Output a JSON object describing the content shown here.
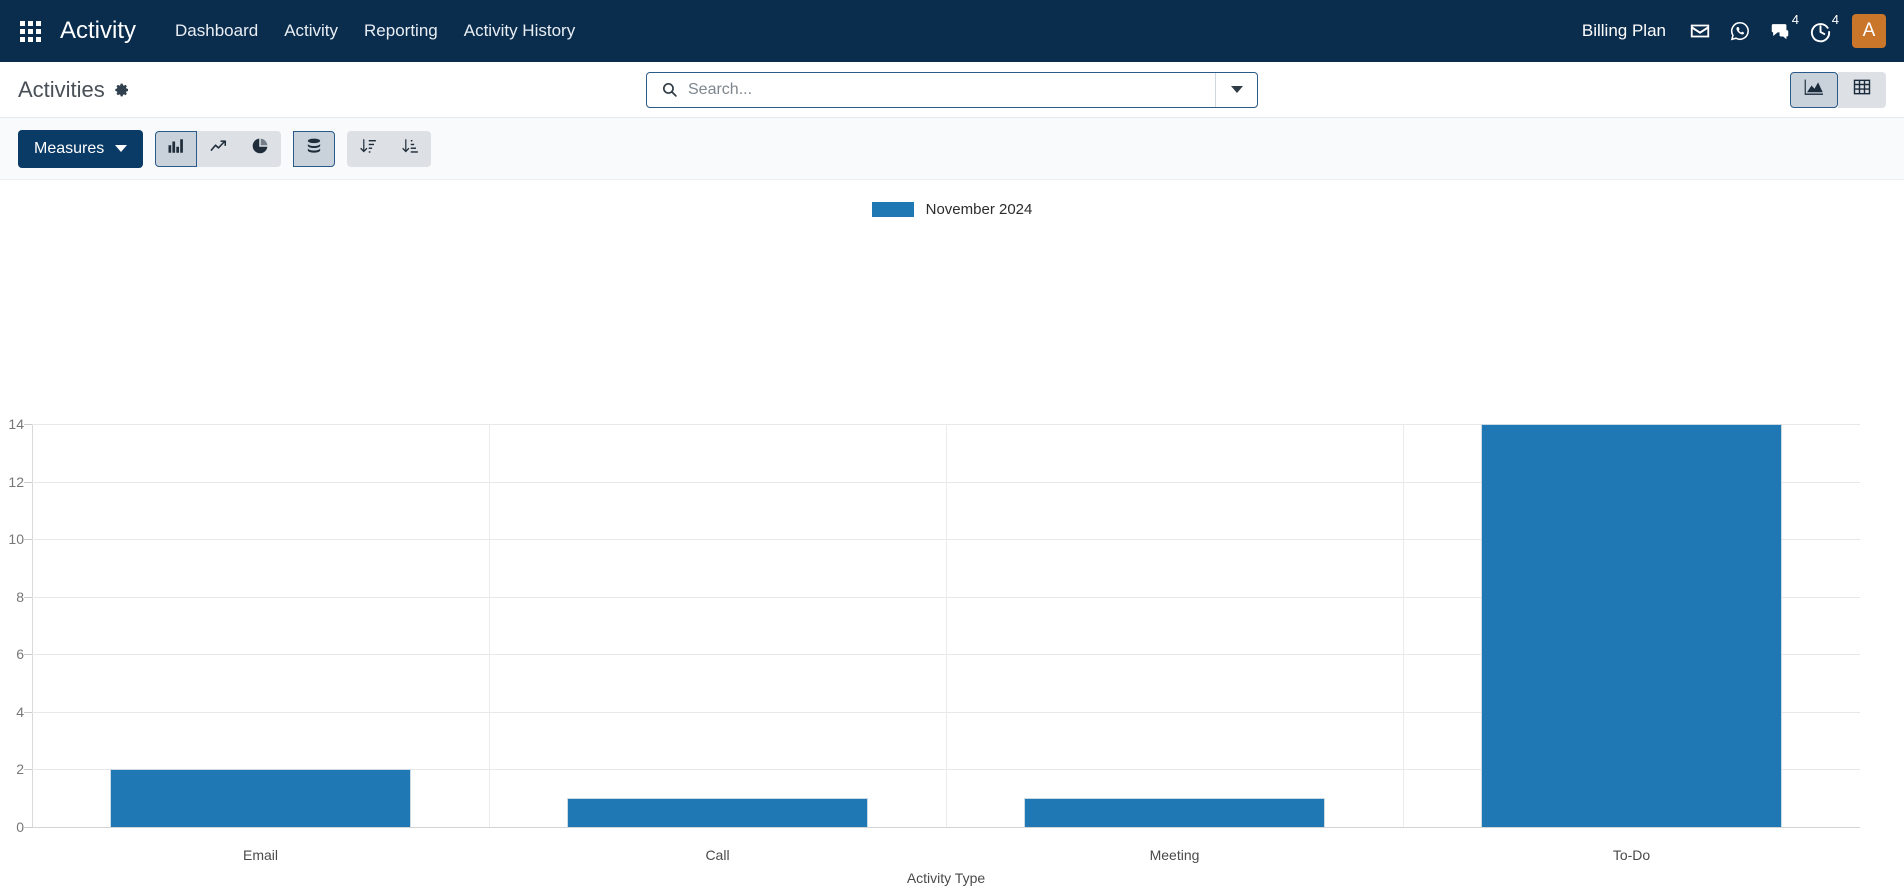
{
  "navbar": {
    "apps_icon": "apps-grid-icon",
    "brand": "Activity",
    "menu": [
      {
        "label": "Dashboard"
      },
      {
        "label": "Activity"
      },
      {
        "label": "Reporting"
      },
      {
        "label": "Activity History"
      }
    ],
    "billing_plan": "Billing Plan",
    "icons": [
      {
        "name": "mail-icon",
        "badge": ""
      },
      {
        "name": "whatsapp-icon",
        "badge": ""
      },
      {
        "name": "messages-icon",
        "badge": "4"
      },
      {
        "name": "activities-clock-icon",
        "badge": "4"
      }
    ],
    "avatar_initial": "A",
    "avatar_color": "#c9762a",
    "background_color": "#0a2c4d"
  },
  "control_panel": {
    "title": "Activities",
    "gear_icon": "gear-icon",
    "search": {
      "placeholder": "Search...",
      "value": "",
      "icon": "search-icon",
      "toggle_icon": "chevron-down-icon"
    },
    "views": [
      {
        "name": "graph",
        "icon": "graph-chart-icon",
        "active": true
      },
      {
        "name": "pivot",
        "icon": "pivot-table-icon",
        "active": false
      }
    ]
  },
  "toolbar": {
    "measures_label": "Measures",
    "measures_caret": "chevron-down-icon",
    "chart_types": [
      {
        "name": "bar-chart",
        "icon": "bar-chart-icon",
        "active": true
      },
      {
        "name": "line-chart",
        "icon": "line-chart-icon",
        "active": false
      },
      {
        "name": "pie-chart",
        "icon": "pie-chart-icon",
        "active": false
      }
    ],
    "options": [
      {
        "name": "stacked",
        "icon": "stacked-database-icon",
        "active": true
      }
    ],
    "sorts": [
      {
        "name": "sort-descending",
        "icon": "sort-descending-icon",
        "active": false
      },
      {
        "name": "sort-ascending",
        "icon": "sort-ascending-icon",
        "active": false
      }
    ]
  },
  "chart_data": {
    "type": "bar",
    "title": "",
    "categories": [
      "Email",
      "Call",
      "Meeting",
      "To-Do"
    ],
    "series": [
      {
        "name": "November 2024",
        "values": [
          2,
          1,
          1,
          14
        ],
        "color": "#1f77b4"
      }
    ],
    "xlabel": "Activity Type",
    "ylabel": "",
    "ylim": [
      0,
      14
    ],
    "yticks": [
      0,
      2,
      4,
      6,
      8,
      10,
      12,
      14
    ],
    "grid": true,
    "legend_position": "top-center"
  }
}
